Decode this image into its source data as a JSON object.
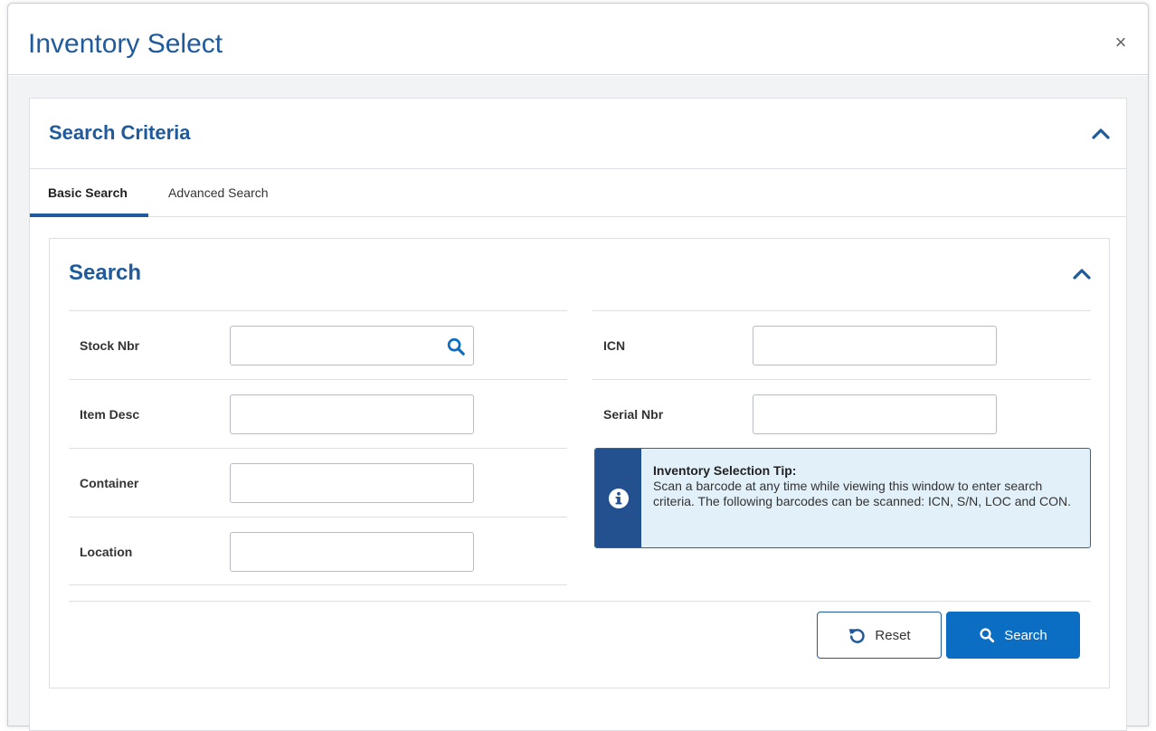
{
  "modal": {
    "title": "Inventory Select",
    "close_label": "×"
  },
  "criteria": {
    "title": "Search Criteria"
  },
  "tabs": [
    {
      "label": "Basic Search",
      "active": true
    },
    {
      "label": "Advanced Search",
      "active": false
    }
  ],
  "search": {
    "title": "Search",
    "fields_left": [
      {
        "label": "Stock Nbr",
        "value": "",
        "has_lookup": true
      },
      {
        "label": "Item Desc",
        "value": ""
      },
      {
        "label": "Container",
        "value": ""
      },
      {
        "label": "Location",
        "value": ""
      }
    ],
    "fields_right": [
      {
        "label": "ICN",
        "value": ""
      },
      {
        "label": "Serial Nbr",
        "value": ""
      }
    ]
  },
  "tip": {
    "title": "Inventory Selection Tip:",
    "text": "Scan a barcode at any time while viewing this window to enter search criteria. The following barcodes can be scanned: ICN, S/N, LOC and CON."
  },
  "buttons": {
    "reset_label": "Reset",
    "search_label": "Search"
  },
  "colors": {
    "brand_blue": "#1f5a9c",
    "primary_button": "#0b6ec2",
    "tip_background": "#e2f0f9",
    "tip_stripe": "#23518f"
  },
  "icons": {
    "close": "close-icon",
    "collapse": "chevron-up-icon",
    "lookup": "search-icon",
    "info": "info-icon",
    "reset": "undo-icon",
    "search": "search-icon"
  }
}
